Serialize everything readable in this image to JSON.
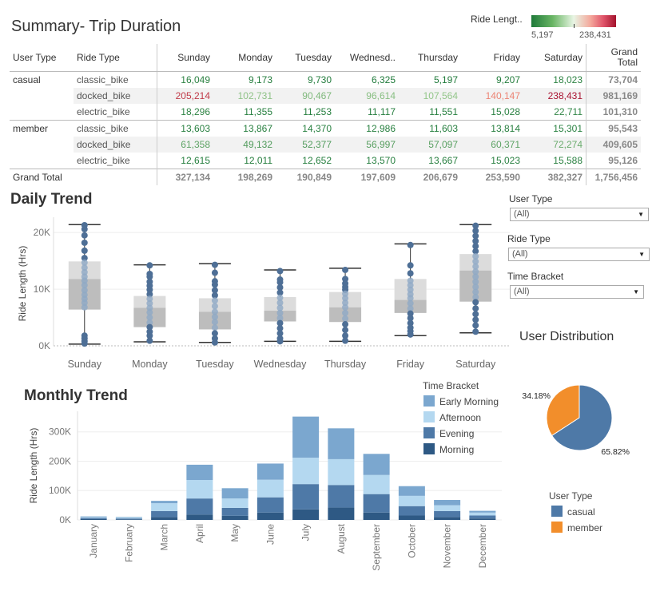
{
  "summary": {
    "title": "Summary- Trip Duration",
    "legend": {
      "title": "Ride Lengt..",
      "min": "5,197",
      "max": "238,431",
      "colors": [
        "#1f7a3a",
        "#e8f5e4",
        "#a3122c"
      ]
    },
    "headers": [
      "User Type",
      "Ride Type",
      "Sunday",
      "Monday",
      "Tuesday",
      "Wednesd..",
      "Thursday",
      "Friday",
      "Saturday",
      "Grand Total"
    ],
    "rows": [
      {
        "user_type": "casual",
        "ride_type": "classic_bike",
        "values": [
          "16,049",
          "9,173",
          "9,730",
          "6,325",
          "5,197",
          "9,207",
          "18,023"
        ],
        "total": "73,704"
      },
      {
        "user_type": "",
        "ride_type": "docked_bike",
        "values": [
          "205,214",
          "102,731",
          "90,467",
          "96,614",
          "107,564",
          "140,147",
          "238,431"
        ],
        "total": "981,169"
      },
      {
        "user_type": "",
        "ride_type": "electric_bike",
        "values": [
          "18,296",
          "11,355",
          "11,253",
          "11,117",
          "11,551",
          "15,028",
          "22,711"
        ],
        "total": "101,310"
      },
      {
        "user_type": "member",
        "ride_type": "classic_bike",
        "values": [
          "13,603",
          "13,867",
          "14,370",
          "12,986",
          "11,603",
          "13,814",
          "15,301"
        ],
        "total": "95,543"
      },
      {
        "user_type": "",
        "ride_type": "docked_bike",
        "values": [
          "61,358",
          "49,132",
          "52,377",
          "56,997",
          "57,097",
          "60,371",
          "72,274"
        ],
        "total": "409,605"
      },
      {
        "user_type": "",
        "ride_type": "electric_bike",
        "values": [
          "12,615",
          "12,011",
          "12,652",
          "13,570",
          "13,667",
          "15,023",
          "15,588"
        ],
        "total": "95,126"
      }
    ],
    "grand_total": {
      "label": "Grand Total",
      "values": [
        "327,134",
        "198,269",
        "190,849",
        "197,609",
        "206,679",
        "253,590",
        "382,327"
      ],
      "total": "1,756,456"
    }
  },
  "daily": {
    "title": "Daily Trend",
    "chart_data": {
      "type": "box",
      "ylabel": "Ride Length (Hrs)",
      "yticks": [
        "0K",
        "10K",
        "20K"
      ],
      "ylim": [
        0,
        22000
      ],
      "categories": [
        "Sunday",
        "Monday",
        "Tuesday",
        "Wednesday",
        "Thursday",
        "Friday",
        "Saturday"
      ],
      "boxes": [
        {
          "min": 300,
          "q1": 6400,
          "median": 11800,
          "q3": 14900,
          "max": 21400
        },
        {
          "min": 700,
          "q1": 3300,
          "median": 6700,
          "q3": 8800,
          "max": 14300
        },
        {
          "min": 600,
          "q1": 2900,
          "median": 6000,
          "q3": 8400,
          "max": 14500
        },
        {
          "min": 800,
          "q1": 4300,
          "median": 6200,
          "q3": 8600,
          "max": 13400
        },
        {
          "min": 800,
          "q1": 4200,
          "median": 6800,
          "q3": 9500,
          "max": 13700
        },
        {
          "min": 1800,
          "q1": 5800,
          "median": 8100,
          "q3": 11800,
          "max": 18000
        },
        {
          "min": 2300,
          "q1": 7800,
          "median": 13300,
          "q3": 16200,
          "max": 21400
        }
      ],
      "points": [
        [
          21300,
          20600,
          19500,
          18200,
          16800,
          15500,
          14700,
          13800,
          13000,
          12200,
          11500,
          10700,
          9800,
          9000,
          8300,
          7600,
          6800,
          1800,
          1300,
          800,
          400
        ],
        [
          14200,
          12700,
          12200,
          11300,
          10600,
          9900,
          9100,
          8300,
          7500,
          6700,
          5900,
          5000,
          4100,
          3300,
          2500,
          1800,
          900
        ],
        [
          14300,
          12900,
          11400,
          10800,
          9800,
          8900,
          8000,
          7000,
          6000,
          5100,
          4200,
          3200,
          2200,
          1300,
          600
        ],
        [
          13200,
          11700,
          11200,
          10300,
          9400,
          8500,
          7600,
          6700,
          5800,
          4900,
          4000,
          3100,
          2200,
          1300,
          800
        ],
        [
          13400,
          11800,
          11000,
          10400,
          9900,
          9200,
          8400,
          7600,
          6800,
          5800,
          4800,
          3800,
          2800,
          1800,
          900
        ],
        [
          17800,
          14200,
          12800,
          11500,
          10700,
          9900,
          9100,
          8400,
          7500,
          6600,
          5700,
          4900,
          4000,
          3200,
          2600,
          2000
        ],
        [
          21200,
          20300,
          19400,
          18500,
          17600,
          16700,
          15800,
          14900,
          14000,
          13100,
          12200,
          11300,
          10400,
          9500,
          8600,
          7700,
          6600,
          5600,
          4600,
          3600,
          2500
        ]
      ]
    }
  },
  "filters": [
    {
      "label": "User Type",
      "value": "(All)"
    },
    {
      "label": "Ride Type",
      "value": "(All)"
    },
    {
      "label": "Time Bracket",
      "value": "(All)"
    }
  ],
  "user_distribution": {
    "title": "User Distribution",
    "chart_data": {
      "type": "pie",
      "slices": [
        {
          "name": "casual",
          "value": 65.82,
          "label": "65.82%",
          "color": "#4e79a7"
        },
        {
          "name": "member",
          "value": 34.18,
          "label": "34.18%",
          "color": "#f28e2b"
        }
      ]
    },
    "legend_title": "User Type"
  },
  "monthly": {
    "title": "Monthly Trend",
    "legend_title": "Time Bracket",
    "chart_data": {
      "type": "bar",
      "stacked": true,
      "ylabel": "Ride Length (Hrs)",
      "yticks": [
        "0K",
        "100K",
        "200K",
        "300K"
      ],
      "ylim": [
        0,
        370000
      ],
      "categories": [
        "January",
        "February",
        "March",
        "April",
        "May",
        "June",
        "July",
        "August",
        "September",
        "October",
        "November",
        "December"
      ],
      "series": [
        {
          "name": "Morning",
          "color": "#2e5984",
          "values": [
            3000,
            2000,
            10000,
            18000,
            14000,
            25000,
            36000,
            42000,
            25000,
            15000,
            10000,
            5000
          ]
        },
        {
          "name": "Evening",
          "color": "#4e79a7",
          "values": [
            4000,
            3000,
            20000,
            55000,
            27000,
            52000,
            86000,
            77000,
            63000,
            32000,
            20000,
            10000
          ]
        },
        {
          "name": "Afternoon",
          "color": "#b4d8f0",
          "values": [
            3000,
            3000,
            27000,
            63000,
            32000,
            60000,
            90000,
            88000,
            65000,
            35000,
            20000,
            10000
          ]
        },
        {
          "name": "Early Morning",
          "color": "#7ba7cf",
          "values": [
            2000,
            2000,
            8000,
            52000,
            35000,
            55000,
            140000,
            105000,
            72000,
            33000,
            18000,
            6000
          ]
        }
      ],
      "legend_order": [
        "Early Morning",
        "Afternoon",
        "Evening",
        "Morning"
      ]
    }
  }
}
